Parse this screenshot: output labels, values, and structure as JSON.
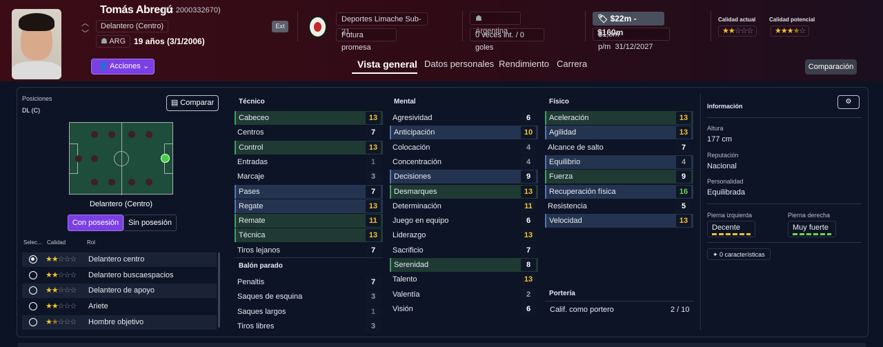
{
  "header": {
    "name": "Tomás Abregú",
    "id": "(ID: 2000332670)",
    "position": "Delantero (Centro)",
    "nation_code": "ARG",
    "age": "19 años (3/1/2006)",
    "ext": "Ext",
    "club": "Deportes Limache Sub-21",
    "club_status": "Futura promesa",
    "country": "Argentina",
    "caps": "0 veces int. / 0 goles",
    "value": "$22m - $160m",
    "wage": "$1,3m p/m",
    "contract": "31/12/2027",
    "current_ability_label": "Calidad actual",
    "potential_ability_label": "Calidad potencial",
    "current_ability_stars": 2,
    "potential_ability_stars": 3.5,
    "actions_label": "Acciones",
    "comparison_label": "Comparación"
  },
  "tabs": [
    "Vista general",
    "Datos personales",
    "Rendimiento",
    "Carrera"
  ],
  "left": {
    "positions_label": "Posiciones",
    "positions_value": "DL (C)",
    "compare_label": "Comparar",
    "pitch_caption": "Delantero (Centro)",
    "with_ball": "Con posesión",
    "without_ball": "Sin posesión",
    "col_select": "Selec...",
    "col_quality": "Calidad",
    "col_role": "Rol",
    "roles": [
      {
        "name": "Delantero centro",
        "stars": 2,
        "selected": true
      },
      {
        "name": "Delantero buscaespacios",
        "stars": 2,
        "selected": false
      },
      {
        "name": "Delantero de apoyo",
        "stars": 2,
        "selected": false
      },
      {
        "name": "Ariete",
        "stars": 2,
        "selected": false
      },
      {
        "name": "Hombre objetivo",
        "stars": 1.5,
        "selected": false
      }
    ]
  },
  "technical": {
    "title": "Técnico",
    "items": [
      [
        "Cabeceo",
        "13"
      ],
      [
        "Centros",
        "7"
      ],
      [
        "Control",
        "13"
      ],
      [
        "Entradas",
        "1"
      ],
      [
        "Marcaje",
        "3"
      ],
      [
        "Pases",
        "7"
      ],
      [
        "Regate",
        "13"
      ],
      [
        "Remate",
        "11"
      ],
      [
        "Técnica",
        "13"
      ],
      [
        "Tiros lejanos",
        "7"
      ]
    ]
  },
  "set_pieces": {
    "title": "Balón parado",
    "items": [
      [
        "Penaltis",
        "7"
      ],
      [
        "Saques de esquina",
        "3"
      ],
      [
        "Saques largos",
        "1"
      ],
      [
        "Tiros libres",
        "3"
      ]
    ]
  },
  "mental": {
    "title": "Mental",
    "items": [
      [
        "Agresividad",
        "6"
      ],
      [
        "Anticipación",
        "10"
      ],
      [
        "Colocación",
        "4"
      ],
      [
        "Concentración",
        "4"
      ],
      [
        "Decisiones",
        "9"
      ],
      [
        "Desmarques",
        "13"
      ],
      [
        "Determinación",
        "11"
      ],
      [
        "Juego en equipo",
        "6"
      ],
      [
        "Liderazgo",
        "13"
      ],
      [
        "Sacrificio",
        "7"
      ],
      [
        "Serenidad",
        "8"
      ],
      [
        "Talento",
        "13"
      ],
      [
        "Valentía",
        "2"
      ],
      [
        "Visión",
        "6"
      ]
    ]
  },
  "physical": {
    "title": "Físico",
    "items": [
      [
        "Aceleración",
        "13"
      ],
      [
        "Agilidad",
        "13"
      ],
      [
        "Alcance de salto",
        "7"
      ],
      [
        "Equilibrio",
        "4"
      ],
      [
        "Fuerza",
        "9"
      ],
      [
        "Recuperación física",
        "16"
      ],
      [
        "Resistencia",
        "5"
      ],
      [
        "Velocidad",
        "13"
      ]
    ]
  },
  "goalkeeping": {
    "title": "Portería",
    "label": "Calif. como portero",
    "value": "2 / 10"
  },
  "info": {
    "title": "Información",
    "height_label": "Altura",
    "height": "177 cm",
    "rep_label": "Reputación",
    "rep": "Nacional",
    "pers_label": "Personalidad",
    "pers": "Equilibrada",
    "left_foot_label": "Pierna izquierda",
    "left_foot": "Decente",
    "right_foot_label": "Pierna derecha",
    "right_foot": "Muy fuerte",
    "traits": "0 características"
  }
}
